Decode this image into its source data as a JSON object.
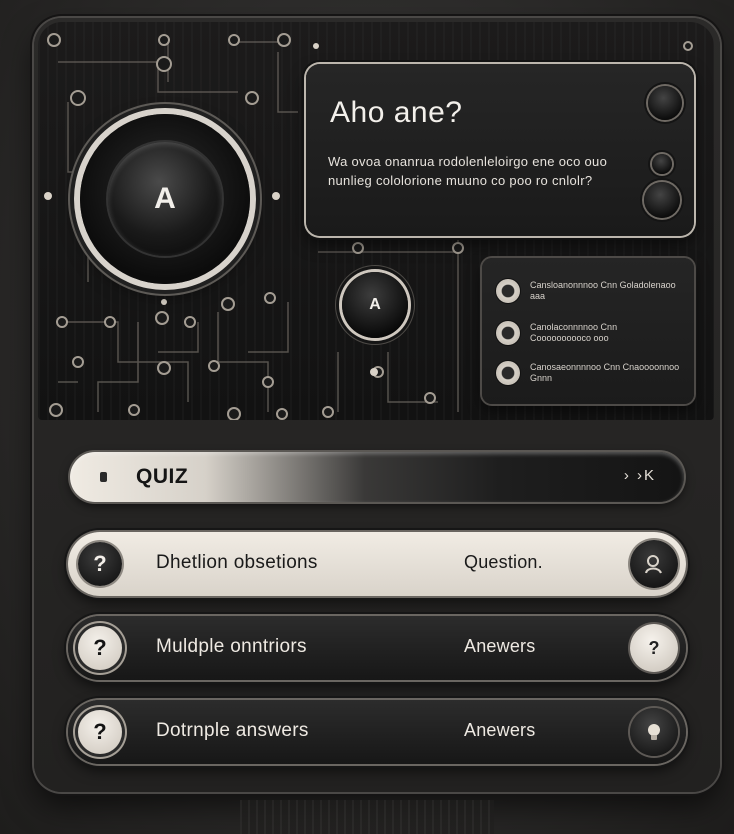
{
  "hero": {
    "big_knob_label": "A",
    "small_knob_label": "A"
  },
  "question_card": {
    "title": "Aho ane?",
    "body": "Wa ovoa onanrua rodolenleloirgo ene oco ouo nunlieg cololorione muuno co poo ro cnlolr?"
  },
  "options_card": {
    "options": [
      {
        "text": "Cansloanonnnoo Cnn Goladolenaoo aaa"
      },
      {
        "text": "Canolaconnnnoo Cnn Coooooooooco ooo"
      },
      {
        "text": "Canosaeonnnnoo Cnn Cnaoooonnoo Gnnn"
      }
    ]
  },
  "search": {
    "label": "QUIZ",
    "icon_text": "› ›K"
  },
  "answers": [
    {
      "badge": "?",
      "label": "Dhetlion obsetions",
      "right": "Question.",
      "end_icon": "user-icon",
      "style": "light"
    },
    {
      "badge": "?",
      "label": "Muldple onntriors",
      "right": "Anewers",
      "end_icon": "?",
      "style": "dark"
    },
    {
      "badge": "?",
      "label": "Dotrnple answers",
      "right": "Anewers",
      "end_icon": "lightbulb-icon",
      "style": "dark"
    }
  ],
  "colors": {
    "accent_cream": "#f0ebe3",
    "panel_dark": "#1b1b1b",
    "frame": "#2b2a29"
  }
}
